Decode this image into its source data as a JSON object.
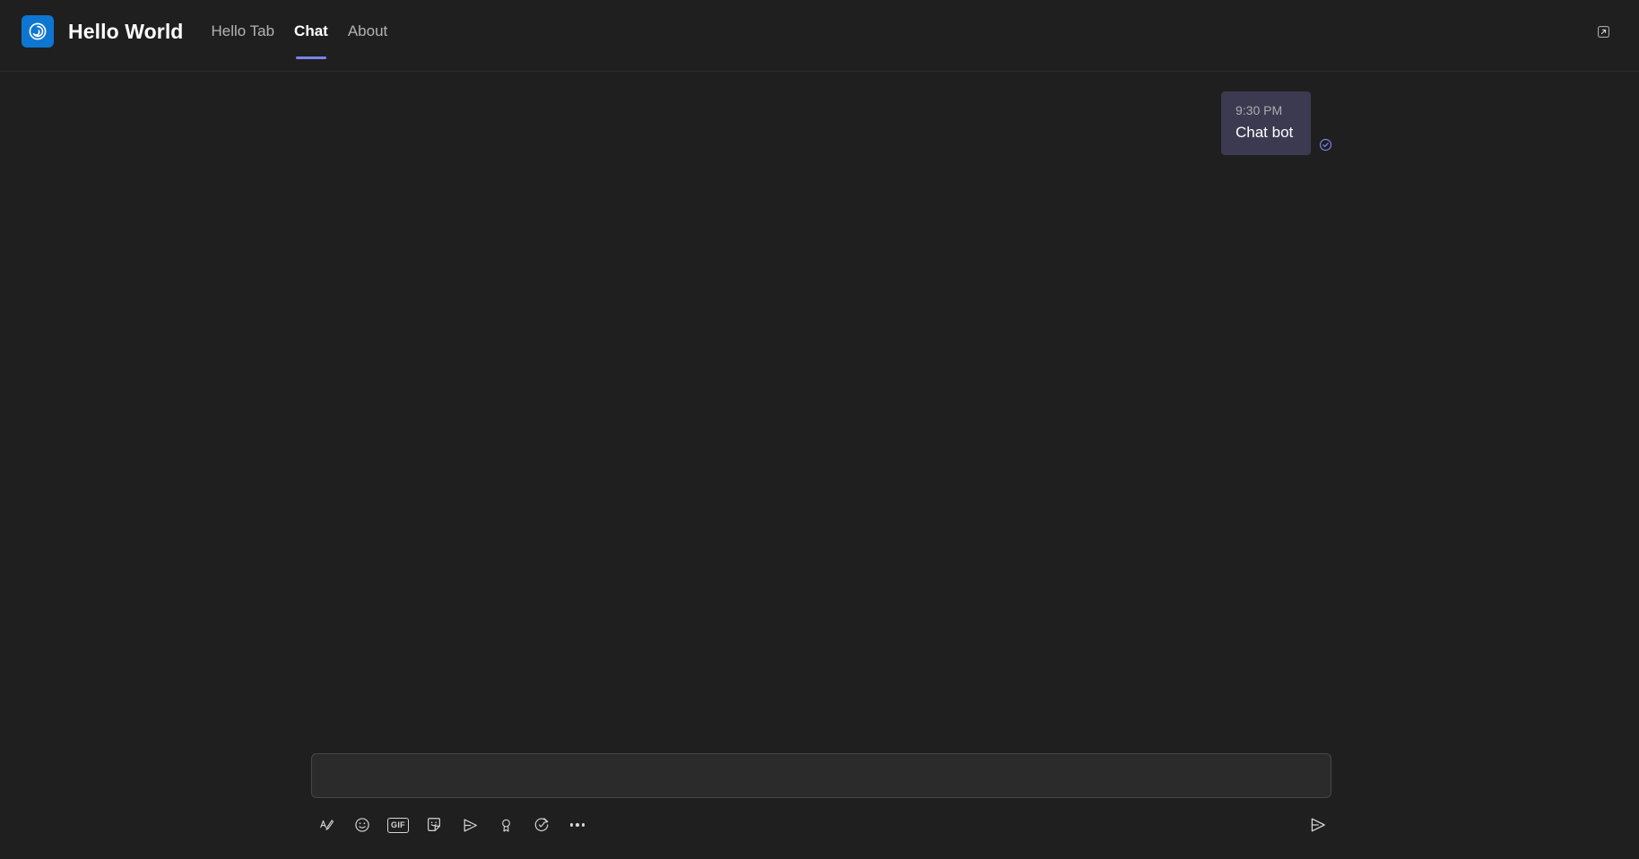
{
  "window": {
    "background_color": "#1f1f1f",
    "accent_color": "#7b83eb",
    "brand_color": "#0d76d1"
  },
  "header": {
    "app_icon_name": "spiral-logo-icon",
    "title": "Hello World",
    "tabs": [
      {
        "label": "Hello Tab",
        "active": false
      },
      {
        "label": "Chat",
        "active": true
      },
      {
        "label": "About",
        "active": false
      }
    ],
    "popout_label": "open-in-new-window"
  },
  "messages": [
    {
      "time": "9:30 PM",
      "text": "Chat bot",
      "status": "sent",
      "bubble_color": "#3b3a50"
    }
  ],
  "compose": {
    "value": "",
    "placeholder": "",
    "toolbar": [
      {
        "name": "format-icon",
        "label": "Format"
      },
      {
        "name": "emoji-icon",
        "label": "Emoji"
      },
      {
        "name": "gif-icon",
        "label": "GIF"
      },
      {
        "name": "sticker-icon",
        "label": "Sticker"
      },
      {
        "name": "send-plane-icon",
        "label": "Send"
      },
      {
        "name": "praise-icon",
        "label": "Praise"
      },
      {
        "name": "schedule-icon",
        "label": "Schedule send"
      },
      {
        "name": "more-options-icon",
        "label": "More options"
      }
    ],
    "send_label": "Send"
  }
}
